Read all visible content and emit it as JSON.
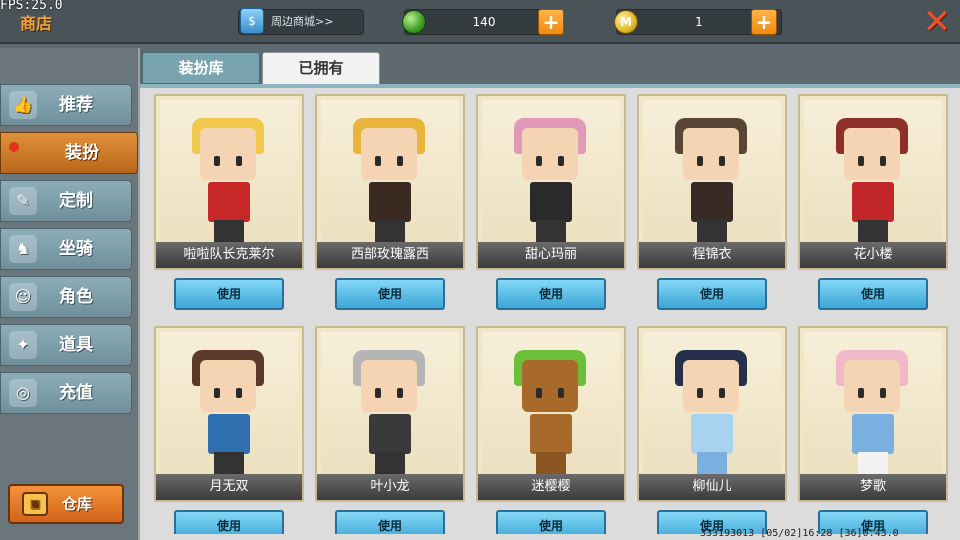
{
  "hud": {
    "fps": "FPS:25.0",
    "title": "商店"
  },
  "topbar": {
    "shop_link": "周边商城>>",
    "gems": "140",
    "coins": "1",
    "plus": "+",
    "close": "✕",
    "coin_glyph": "M"
  },
  "sidebar": {
    "items": [
      {
        "label": "推荐",
        "icon": "thumb-icon",
        "active": false
      },
      {
        "label": "装扮",
        "icon": "costume-icon",
        "active": true
      },
      {
        "label": "定制",
        "icon": "pencil-icon",
        "active": false
      },
      {
        "label": "坐骑",
        "icon": "mount-icon",
        "active": false
      },
      {
        "label": "角色",
        "icon": "character-icon",
        "active": false
      },
      {
        "label": "道具",
        "icon": "item-icon",
        "active": false
      },
      {
        "label": "充值",
        "icon": "coins-icon",
        "active": false
      }
    ],
    "warehouse": "仓库"
  },
  "tabs": {
    "library": "装扮库",
    "owned": "已拥有"
  },
  "cards": [
    {
      "name": "啦啦队长克莱尔",
      "button": "使用",
      "hair": "#f2c94c",
      "body": "#c62828"
    },
    {
      "name": "西部玫瑰露西",
      "button": "使用",
      "hair": "#e8b43a",
      "body": "#3a2a22"
    },
    {
      "name": "甜心玛丽",
      "button": "使用",
      "hair": "#e09ab8",
      "body": "#2a2a2a"
    },
    {
      "name": "程锦衣",
      "button": "使用",
      "hair": "#5a4636",
      "body": "#3a2a26"
    },
    {
      "name": "花小楼",
      "button": "使用",
      "hair": "#8e2f2a",
      "body": "#c0262a"
    },
    {
      "name": "月无双",
      "button": "使用",
      "hair": "#5c3a2a",
      "body": "#2f6fb0"
    },
    {
      "name": "叶小龙",
      "button": "使用",
      "hair": "#b5b5b5",
      "body": "#3a3a3a"
    },
    {
      "name": "迷樱樱",
      "button": "使用",
      "hair": "#6dbf3a",
      "body": "#a86a2a"
    },
    {
      "name": "柳仙儿",
      "button": "使用",
      "hair": "#26304a",
      "body": "#a8d2f0"
    },
    {
      "name": "梦歌",
      "button": "使用",
      "hair": "#f0b8c8",
      "body": "#7ab0e0"
    }
  ],
  "footer": "333193013   [05/02]16:28   [36]0.43.0"
}
